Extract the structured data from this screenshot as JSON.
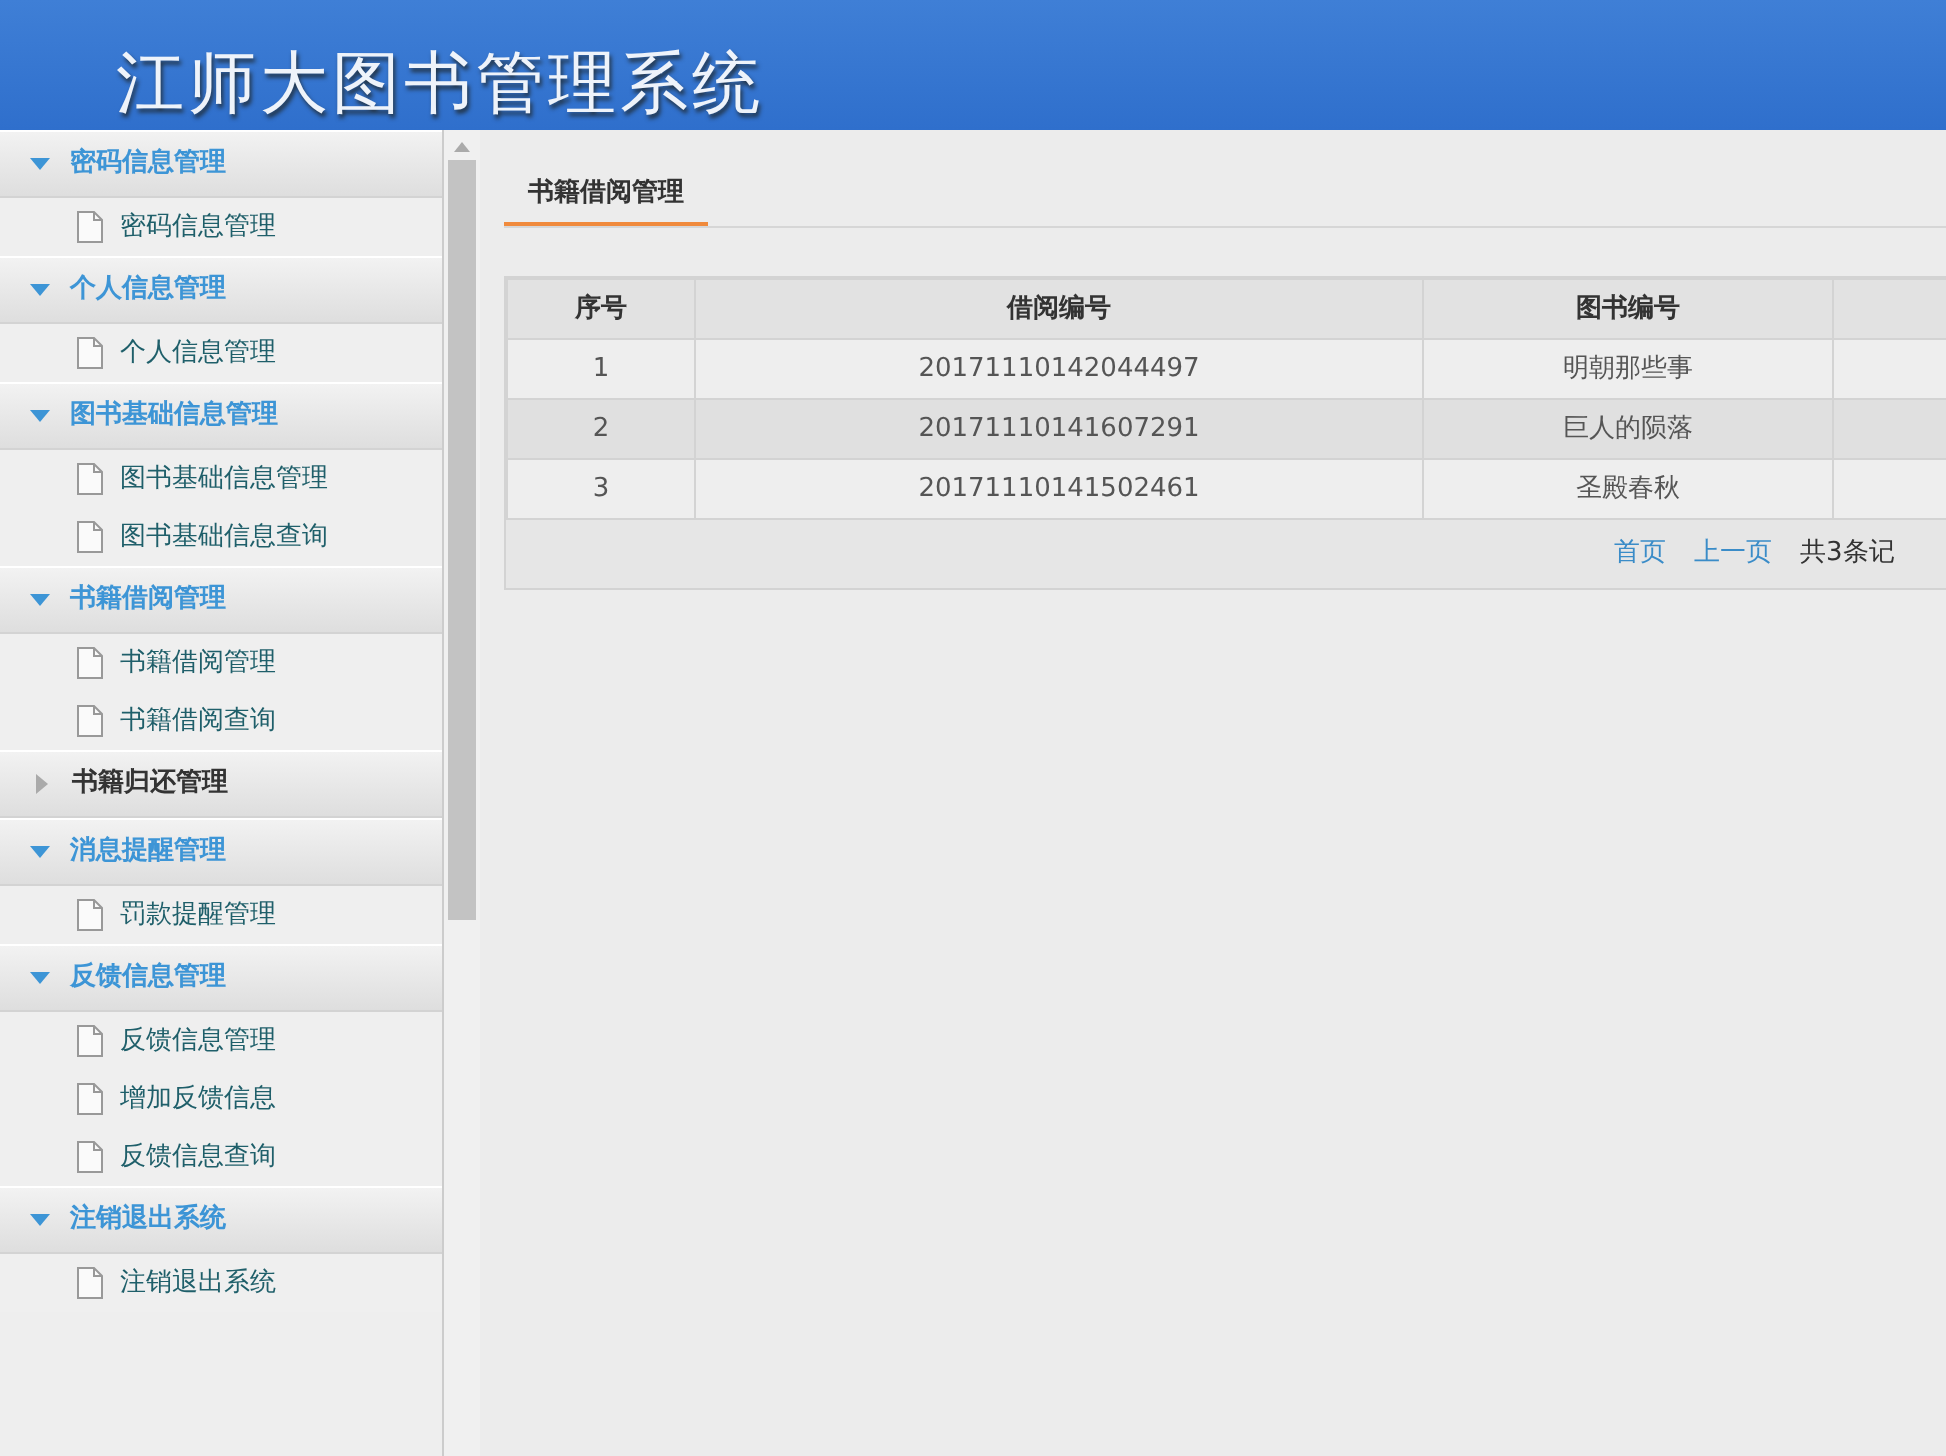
{
  "header": {
    "title": "江师大图书管理系统"
  },
  "sidebar": {
    "groups": [
      {
        "label": "密码信息管理",
        "expanded": true,
        "items": [
          {
            "label": "密码信息管理"
          }
        ]
      },
      {
        "label": "个人信息管理",
        "expanded": true,
        "items": [
          {
            "label": "个人信息管理"
          }
        ]
      },
      {
        "label": "图书基础信息管理",
        "expanded": true,
        "items": [
          {
            "label": "图书基础信息管理"
          },
          {
            "label": "图书基础信息查询"
          }
        ]
      },
      {
        "label": "书籍借阅管理",
        "expanded": true,
        "items": [
          {
            "label": "书籍借阅管理"
          },
          {
            "label": "书籍借阅查询"
          }
        ]
      },
      {
        "label": "书籍归还管理",
        "expanded": false
      },
      {
        "label": "消息提醒管理",
        "expanded": true,
        "items": [
          {
            "label": "罚款提醒管理"
          }
        ]
      },
      {
        "label": "反馈信息管理",
        "expanded": true,
        "items": [
          {
            "label": "反馈信息管理"
          },
          {
            "label": "增加反馈信息"
          },
          {
            "label": "反馈信息查询"
          }
        ]
      },
      {
        "label": "注销退出系统",
        "expanded": true,
        "items": [
          {
            "label": "注销退出系统"
          }
        ]
      }
    ]
  },
  "tabs": [
    {
      "label": "书籍借阅管理",
      "selected": true
    }
  ],
  "table": {
    "columns": [
      "序号",
      "借阅编号",
      "图书编号",
      ""
    ],
    "rows": [
      [
        "1",
        "20171110142044497",
        "明朝那些事",
        ""
      ],
      [
        "2",
        "20171110141607291",
        "巨人的陨落",
        ""
      ],
      [
        "3",
        "20171110141502461",
        "圣殿春秋",
        ""
      ]
    ]
  },
  "pager": {
    "links": [
      "首页",
      "上一页"
    ],
    "summary": "共3条记"
  }
}
